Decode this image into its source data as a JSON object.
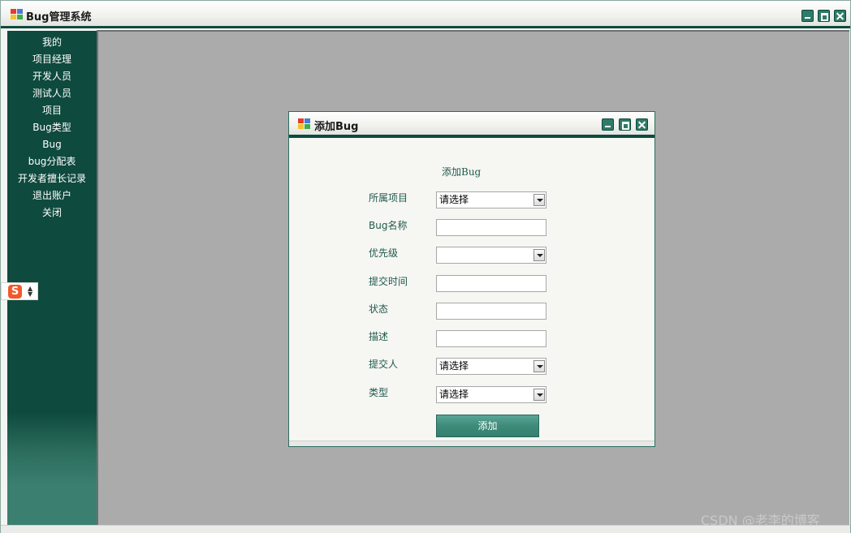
{
  "window": {
    "title": "Bug管理系统"
  },
  "sidebar": {
    "items": [
      {
        "label": "我的"
      },
      {
        "label": "项目经理"
      },
      {
        "label": "开发人员"
      },
      {
        "label": "测试人员"
      },
      {
        "label": "项目"
      },
      {
        "label": "Bug类型"
      },
      {
        "label": "Bug"
      },
      {
        "label": "bug分配表"
      },
      {
        "label": "开发者擅长记录"
      },
      {
        "label": "退出账户"
      },
      {
        "label": "关闭"
      }
    ]
  },
  "ime": {
    "logo": "S"
  },
  "dialog": {
    "title": "添加Bug",
    "heading": "添加Bug",
    "fields": [
      {
        "label": "所属项目",
        "value": "请选择"
      },
      {
        "label": "Bug名称",
        "value": ""
      },
      {
        "label": "优先级",
        "value": ""
      },
      {
        "label": "提交时间",
        "value": ""
      },
      {
        "label": "状态",
        "value": ""
      },
      {
        "label": "描述",
        "value": ""
      },
      {
        "label": "提交人",
        "value": "请选择"
      },
      {
        "label": "类型",
        "value": "请选择"
      }
    ],
    "submit_label": "添加"
  },
  "watermark": "CSDN @老李的博客",
  "colors": {
    "sidebar": "#0e4a3e",
    "accent": "#3f8a79",
    "workspace": "#ababab"
  },
  "icons": {
    "app": "app-windows-icon",
    "minimize": "minimize-icon",
    "maximize": "maximize-icon",
    "close": "close-icon",
    "dropdown": "chevron-down-icon"
  }
}
